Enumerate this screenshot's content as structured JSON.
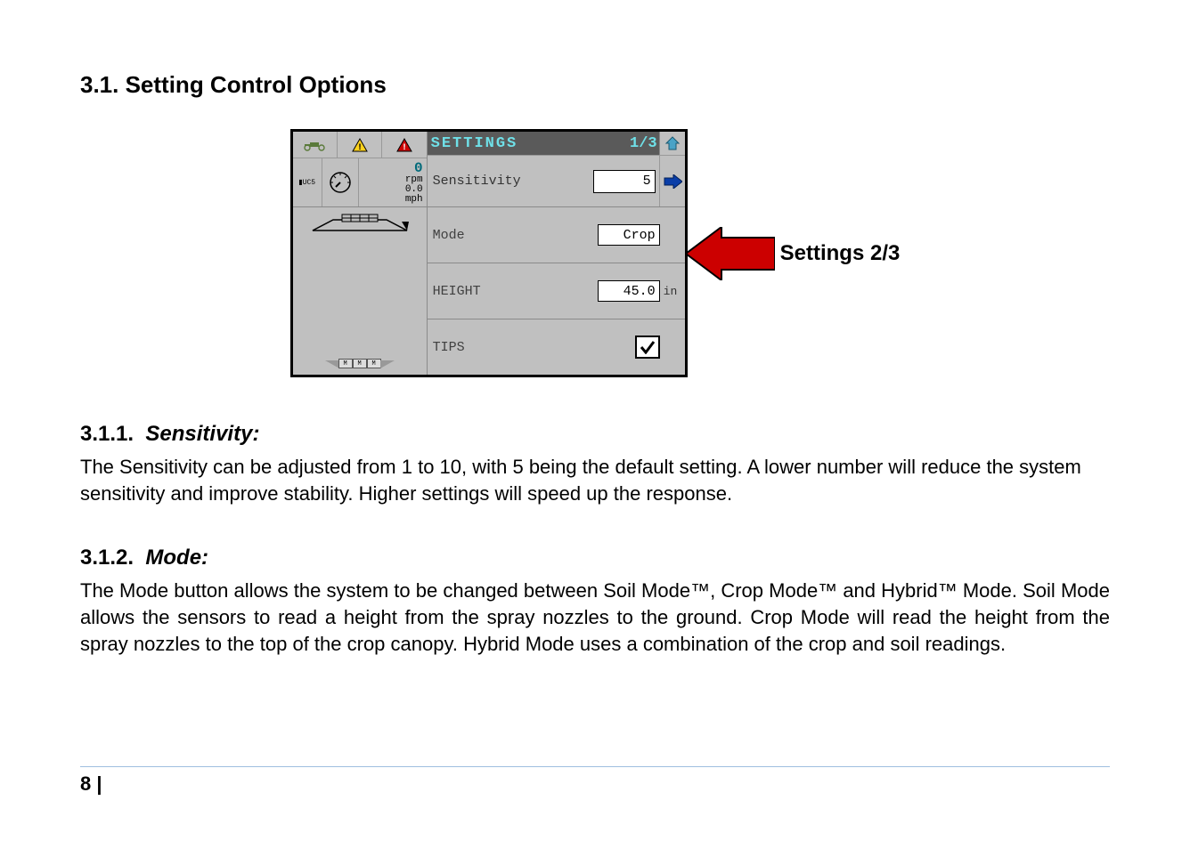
{
  "section_heading": "3.1.  Setting Control Options",
  "panel": {
    "title": "SETTINGS",
    "page_indicator": "1/3",
    "status": {
      "ucs_label": "UC5",
      "rpm_value": "0",
      "rpm_label": "rpm",
      "speed_value": "0.0",
      "speed_unit": "mph"
    },
    "rows": {
      "sensitivity": {
        "label": "Sensitivity",
        "value": "5"
      },
      "mode": {
        "label": "Mode",
        "value": "Crop"
      },
      "height": {
        "label": "HEIGHT",
        "value": "45.0",
        "unit": "in"
      },
      "tips": {
        "label": "TIPS",
        "checked": true
      }
    },
    "boom_labels": [
      "M",
      "M",
      "M"
    ]
  },
  "callout_label": "Settings 2/3",
  "sub1": {
    "num": "3.1.1.",
    "title": "Sensitivity:",
    "body": "The Sensitivity can be adjusted from 1 to 10, with 5 being the default setting.  A lower number will reduce the system sensitivity and improve stability.  Higher settings will speed up the response."
  },
  "sub2": {
    "num": "3.1.2.",
    "title": "Mode:",
    "body": "The Mode button allows the system to be changed between Soil Mode™, Crop Mode™ and Hybrid™ Mode.  Soil Mode allows the sensors to read a height from the spray nozzles to the ground. Crop Mode will read the height from the spray nozzles to the top of the crop canopy.  Hybrid Mode uses a combination of the crop and soil readings."
  },
  "footer": "8 |"
}
